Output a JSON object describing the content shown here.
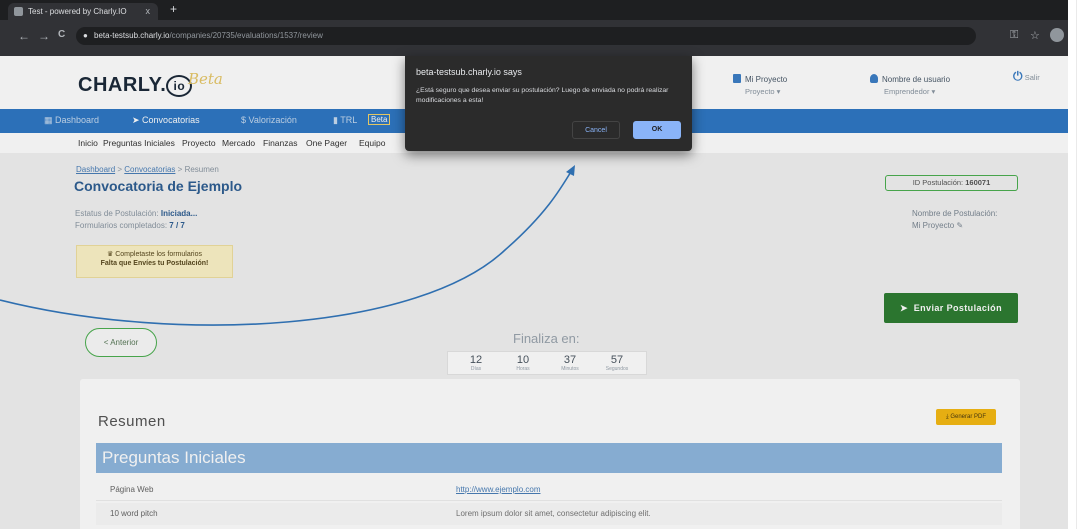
{
  "browser": {
    "tab_title": "Test - powered by Charly.IO",
    "tab_close": "x",
    "new_tab": "+",
    "back": "←",
    "forward": "→",
    "reload": "C",
    "url_host": "beta-testsub.charly.io",
    "url_path": "/companies/20735/evaluations/1537/review",
    "key_icon": "⚿",
    "star": "☆"
  },
  "header": {
    "logo_text": "CHARLY.",
    "logo_io": "io",
    "beta_script": "Beta",
    "project_label": "Mi Proyecto",
    "project_sub": "Proyecto ▾",
    "user_label": "Nombre de usuario",
    "user_sub": "Emprendedor ▾",
    "logout": "Salir",
    "power_icon": "⏻"
  },
  "bluenav": {
    "dashboard": "Dashboard",
    "convocatorias": "Convocatorias",
    "valorizacion": "$ Valorización",
    "trl": "TRL",
    "beta": "Beta"
  },
  "subnav": [
    "Inicio",
    "Preguntas Iniciales",
    "Proyecto",
    "Mercado",
    "Finanzas",
    "One Pager",
    "Equipo"
  ],
  "page": {
    "crumb_dashboard": "Dashboard",
    "crumb_sep": ">",
    "crumb_conv": "Convocatorias",
    "crumb_current": "Resumen",
    "title": "Convocatoria de Ejemplo",
    "status_label": "Estatus de Postulación:",
    "status_value": "Iniciada...",
    "forms_label": "Formularios completados:",
    "forms_value": "7 / 7",
    "notice_line1": "Completaste los formularios",
    "notice_line2": "Falta que Envíes tu Postulación!",
    "id_label": "ID Postulación:",
    "id_value": "160071",
    "nom_label": "Nombre de Postulación:",
    "nom_value": "Mi Proyecto",
    "send_button": "Enviar Postulación",
    "prev_button": "< Anterior",
    "finaliza": "Finaliza en:",
    "timer": [
      {
        "n": "12",
        "l": "Días"
      },
      {
        "n": "10",
        "l": "Horas"
      },
      {
        "n": "37",
        "l": "Minutos"
      },
      {
        "n": "57",
        "l": "Segundos"
      }
    ],
    "resumen": "Resumen",
    "pdf_button": "Generar PDF",
    "section": "Preguntas Iniciales",
    "rows": [
      {
        "k": "Página Web",
        "v": "http://www.ejemplo.com"
      },
      {
        "k": "10 word pitch",
        "v": "Lorem ipsum dolor sit amet, consectetur adipiscing elit."
      }
    ]
  },
  "dialog": {
    "title": "beta-testsub.charly.io says",
    "message": "¿Está seguro que desea enviar su postulación? Luego de enviada no podrá realizar modificaciones a esta!",
    "cancel": "Cancel",
    "ok": "OK"
  },
  "colors": {
    "nav_blue": "#2f78c4",
    "send_green": "#2e7d32",
    "section_blue": "#8fb7df",
    "dialog_bg": "#2b2b2b",
    "annotation_arrow": "#2f6fb0"
  }
}
